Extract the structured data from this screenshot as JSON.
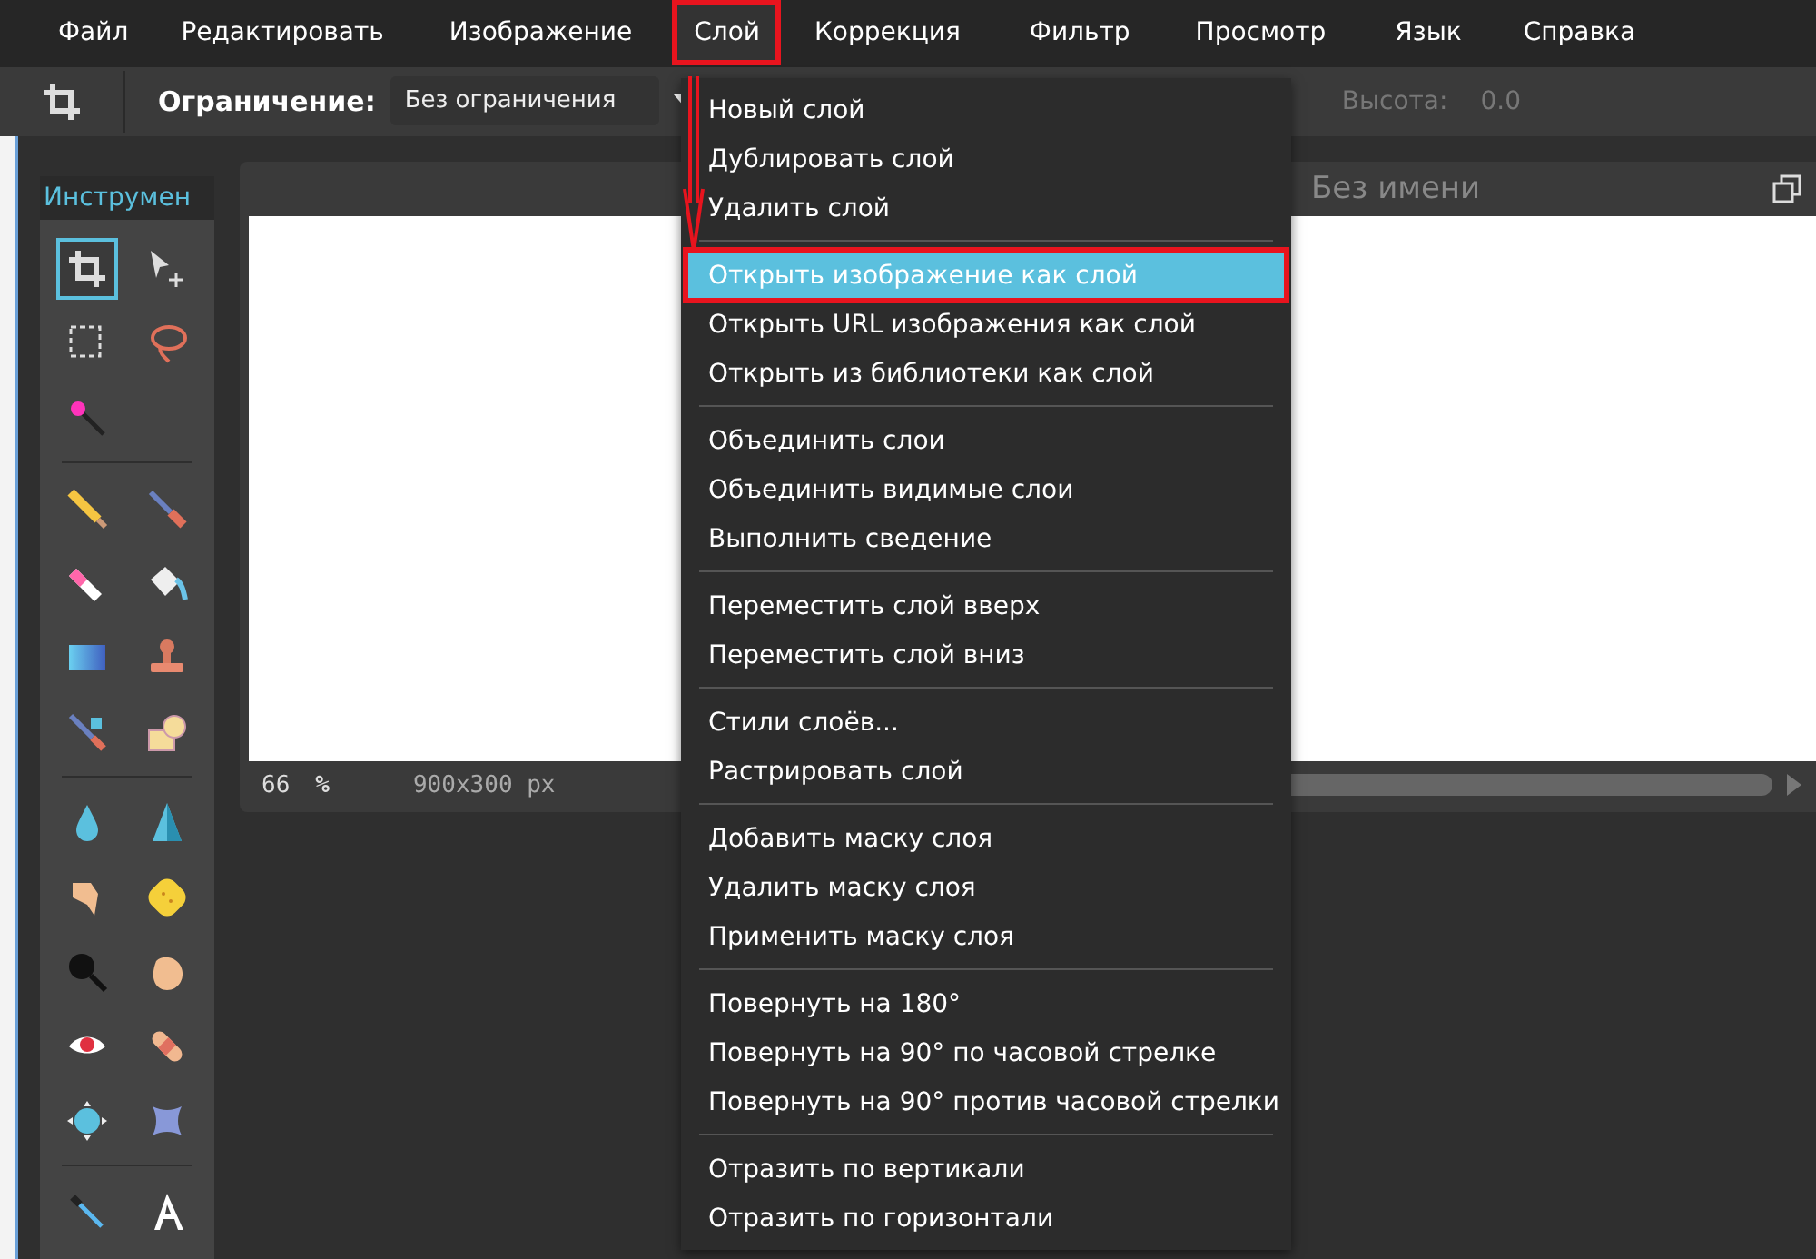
{
  "menubar": [
    {
      "label": "Файл",
      "open": false,
      "annotated": false
    },
    {
      "label": "Редактировать",
      "open": false,
      "annotated": false
    },
    {
      "label": "Изображение",
      "open": false,
      "annotated": false
    },
    {
      "label": "Слой",
      "open": true,
      "annotated": true
    },
    {
      "label": "Коррекция",
      "open": false,
      "annotated": false
    },
    {
      "label": "Фильтр",
      "open": false,
      "annotated": false
    },
    {
      "label": "Просмотр",
      "open": false,
      "annotated": false
    },
    {
      "label": "Язык",
      "open": false,
      "annotated": false
    },
    {
      "label": "Справка",
      "open": false,
      "annotated": false
    }
  ],
  "toolbar": {
    "constraint_label": "Ограничение:",
    "constraint_value": "Без ограничения",
    "height_label": "Высота:",
    "height_value": "0.0"
  },
  "tools_panel": {
    "title": "Инструмен",
    "groups": [
      [
        {
          "kind": "crop",
          "selected": true
        },
        {
          "kind": "move",
          "selected": false
        },
        {
          "kind": "marquee",
          "selected": false
        },
        {
          "kind": "lasso",
          "selected": false
        },
        {
          "kind": "wand",
          "selected": false
        }
      ],
      [
        {
          "kind": "pencil",
          "selected": false
        },
        {
          "kind": "brush",
          "selected": false
        },
        {
          "kind": "eraser",
          "selected": false
        },
        {
          "kind": "bucket",
          "selected": false
        },
        {
          "kind": "gradient",
          "selected": false
        },
        {
          "kind": "stamp",
          "selected": false
        },
        {
          "kind": "replace",
          "selected": false
        },
        {
          "kind": "shape",
          "selected": false
        }
      ],
      [
        {
          "kind": "drop",
          "selected": false
        },
        {
          "kind": "sharpen",
          "selected": false
        },
        {
          "kind": "smudge",
          "selected": false
        },
        {
          "kind": "sponge",
          "selected": false
        },
        {
          "kind": "burn",
          "selected": false
        },
        {
          "kind": "dodge",
          "selected": false
        },
        {
          "kind": "redeye",
          "selected": false
        },
        {
          "kind": "bandage",
          "selected": false
        },
        {
          "kind": "bloat",
          "selected": false
        },
        {
          "kind": "pinch",
          "selected": false
        }
      ],
      [
        {
          "kind": "picker",
          "selected": false
        },
        {
          "kind": "text",
          "selected": false
        }
      ]
    ]
  },
  "document": {
    "title": "Без имени",
    "zoom": "66",
    "zoom_unit": "%",
    "size": "900x300 px"
  },
  "layer_menu": [
    {
      "kind": "item",
      "label": "Новый слой",
      "selected": false,
      "annotated": false
    },
    {
      "kind": "item",
      "label": "Дублировать слой",
      "selected": false,
      "annotated": false
    },
    {
      "kind": "item",
      "label": "Удалить слой",
      "selected": false,
      "annotated": false
    },
    {
      "kind": "separator"
    },
    {
      "kind": "item",
      "label": "Открыть изображение как слой",
      "selected": true,
      "annotated": true
    },
    {
      "kind": "item",
      "label": "Открыть URL изображения как слой",
      "selected": false,
      "annotated": false
    },
    {
      "kind": "item",
      "label": "Открыть из библиотеки как слой",
      "selected": false,
      "annotated": false
    },
    {
      "kind": "separator"
    },
    {
      "kind": "item",
      "label": "Объединить слои",
      "selected": false,
      "annotated": false
    },
    {
      "kind": "item",
      "label": "Объединить видимые слои",
      "selected": false,
      "annotated": false
    },
    {
      "kind": "item",
      "label": "Выполнить сведение",
      "selected": false,
      "annotated": false
    },
    {
      "kind": "separator"
    },
    {
      "kind": "item",
      "label": "Переместить слой вверх",
      "selected": false,
      "annotated": false
    },
    {
      "kind": "item",
      "label": "Переместить слой вниз",
      "selected": false,
      "annotated": false
    },
    {
      "kind": "separator"
    },
    {
      "kind": "item",
      "label": "Стили слоёв...",
      "selected": false,
      "annotated": false
    },
    {
      "kind": "item",
      "label": "Растрировать слой",
      "selected": false,
      "annotated": false
    },
    {
      "kind": "separator"
    },
    {
      "kind": "item",
      "label": "Добавить маску слоя",
      "selected": false,
      "annotated": false
    },
    {
      "kind": "item",
      "label": "Удалить маску слоя",
      "selected": false,
      "annotated": false
    },
    {
      "kind": "item",
      "label": "Применить маску слоя",
      "selected": false,
      "annotated": false
    },
    {
      "kind": "separator"
    },
    {
      "kind": "item",
      "label": "Повернуть на 180°",
      "selected": false,
      "annotated": false
    },
    {
      "kind": "item",
      "label": "Повернуть на 90° по часовой стрелке",
      "selected": false,
      "annotated": false
    },
    {
      "kind": "item",
      "label": "Повернуть на 90° против часовой стрелки",
      "selected": false,
      "annotated": false
    },
    {
      "kind": "separator"
    },
    {
      "kind": "item",
      "label": "Отразить по вертикали",
      "selected": false,
      "annotated": false
    },
    {
      "kind": "item",
      "label": "Отразить по горизонтали",
      "selected": false,
      "annotated": false
    }
  ]
}
